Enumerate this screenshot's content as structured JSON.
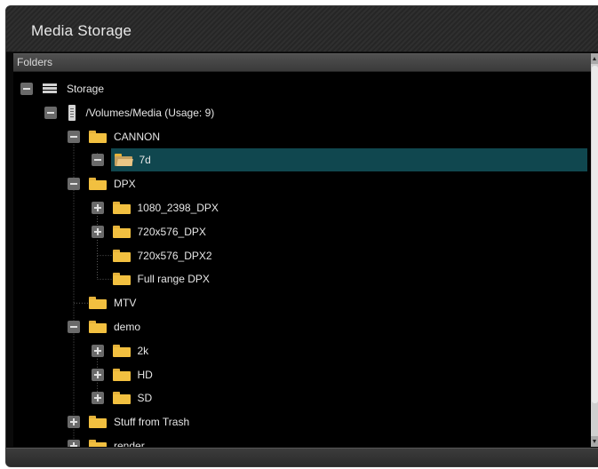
{
  "window": {
    "title": "Media Storage"
  },
  "panel": {
    "header": "Folders"
  },
  "tree": {
    "rows": [
      {
        "label": "Storage",
        "depth": 0,
        "toggle": "minus",
        "icon": "drive-icon"
      },
      {
        "label": "/Volumes/Media (Usage: 9)",
        "depth": 1,
        "toggle": "minus",
        "icon": "disk-icon"
      },
      {
        "label": "CANNON",
        "depth": 2,
        "toggle": "minus",
        "icon": "folder-icon"
      },
      {
        "label": "7d",
        "depth": 3,
        "toggle": "minus",
        "icon": "folder-open-icon",
        "selected": true
      },
      {
        "label": "DPX",
        "depth": 2,
        "toggle": "minus",
        "icon": "folder-icon"
      },
      {
        "label": "1080_2398_DPX",
        "depth": 3,
        "toggle": "plus",
        "icon": "folder-icon"
      },
      {
        "label": "720x576_DPX",
        "depth": 3,
        "toggle": "plus",
        "icon": "folder-icon"
      },
      {
        "label": "720x576_DPX2",
        "depth": 3,
        "toggle": "none",
        "icon": "folder-icon"
      },
      {
        "label": "Full range DPX",
        "depth": 3,
        "toggle": "none",
        "icon": "folder-icon"
      },
      {
        "label": "MTV",
        "depth": 2,
        "toggle": "none",
        "icon": "folder-icon"
      },
      {
        "label": "demo",
        "depth": 2,
        "toggle": "minus",
        "icon": "folder-icon"
      },
      {
        "label": "2k",
        "depth": 3,
        "toggle": "plus",
        "icon": "folder-icon"
      },
      {
        "label": "HD",
        "depth": 3,
        "toggle": "plus",
        "icon": "folder-icon"
      },
      {
        "label": "SD",
        "depth": 3,
        "toggle": "plus",
        "icon": "folder-icon"
      },
      {
        "label": "Stuff from Trash",
        "depth": 2,
        "toggle": "plus",
        "icon": "folder-icon"
      },
      {
        "label": "render",
        "depth": 2,
        "toggle": "plus",
        "icon": "folder-icon"
      }
    ]
  },
  "colors": {
    "selection": "#10474f",
    "folder": "#f2c040",
    "background": "#000000"
  }
}
